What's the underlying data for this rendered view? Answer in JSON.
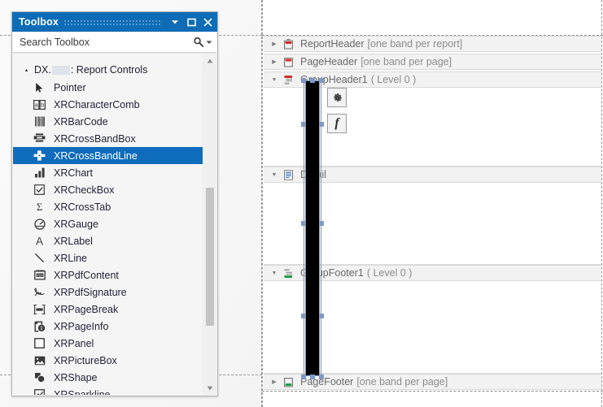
{
  "toolbox": {
    "title": "Toolbox",
    "titlebar_buttons": [
      {
        "name": "toolbox-dropdown-button",
        "icon": "chevron-down-icon",
        "glyph": "▼"
      },
      {
        "name": "toolbox-maximize-button",
        "icon": "maximize-icon",
        "glyph": "□"
      },
      {
        "name": "toolbox-close-button",
        "icon": "close-icon",
        "glyph": "✕"
      }
    ],
    "search": {
      "text": "Search Toolbox",
      "placeholder": "Search Toolbox",
      "icon": "search-icon",
      "dropdown_icon": "chevron-down-icon"
    },
    "group": {
      "expander": "▴",
      "prefix": "DX.",
      "redacted": true,
      "suffix": ": Report Controls",
      "full_label": "DX. : Report Controls"
    },
    "items": [
      {
        "label": "Pointer",
        "icon": "pointer-icon",
        "selected": false
      },
      {
        "label": "XRCharacterComb",
        "icon": "character-comb-icon",
        "selected": false
      },
      {
        "label": "XRBarCode",
        "icon": "barcode-icon",
        "selected": false
      },
      {
        "label": "XRCrossBandBox",
        "icon": "cross-band-box-icon",
        "selected": false
      },
      {
        "label": "XRCrossBandLine",
        "icon": "cross-band-line-icon",
        "selected": true
      },
      {
        "label": "XRChart",
        "icon": "chart-icon",
        "selected": false
      },
      {
        "label": "XRCheckBox",
        "icon": "checkbox-icon",
        "selected": false
      },
      {
        "label": "XRCrossTab",
        "icon": "cross-tab-icon",
        "selected": false
      },
      {
        "label": "XRGauge",
        "icon": "gauge-icon",
        "selected": false
      },
      {
        "label": "XRLabel",
        "icon": "label-icon",
        "selected": false
      },
      {
        "label": "XRLine",
        "icon": "line-icon",
        "selected": false
      },
      {
        "label": "XRPdfContent",
        "icon": "pdf-content-icon",
        "selected": false
      },
      {
        "label": "XRPdfSignature",
        "icon": "pdf-signature-icon",
        "selected": false
      },
      {
        "label": "XRPageBreak",
        "icon": "page-break-icon",
        "selected": false
      },
      {
        "label": "XRPageInfo",
        "icon": "page-info-icon",
        "selected": false
      },
      {
        "label": "XRPanel",
        "icon": "panel-icon",
        "selected": false
      },
      {
        "label": "XRPictureBox",
        "icon": "picture-box-icon",
        "selected": false
      },
      {
        "label": "XRShape",
        "icon": "shape-icon",
        "selected": false
      },
      {
        "label": "XRSparkline",
        "icon": "sparkline-icon",
        "selected": false
      }
    ],
    "scrollbar": {
      "up_glyph": "▲",
      "down_glyph": "▼"
    }
  },
  "designer": {
    "bands": [
      {
        "name": "ReportHeader",
        "suffix": "[one band per report]",
        "expanded": false,
        "icon": "report-header-band-icon"
      },
      {
        "name": "PageHeader",
        "suffix": "[one band per page]",
        "expanded": false,
        "icon": "page-header-band-icon"
      },
      {
        "name": "GroupHeader1",
        "suffix": "( Level 0 )",
        "expanded": true,
        "icon": "group-header-band-icon"
      },
      {
        "name": "Detail",
        "suffix": "",
        "expanded": true,
        "icon": "detail-band-icon"
      },
      {
        "name": "GroupFooter1",
        "suffix": "( Level 0 )",
        "expanded": true,
        "icon": "group-footer-band-icon"
      },
      {
        "name": "PageFooter",
        "suffix": "[one band per page]",
        "expanded": false,
        "icon": "page-footer-band-icon"
      }
    ],
    "expander_collapsed_glyph": "▶",
    "expander_expanded_glyph": "▼",
    "selected_control": {
      "name": "XRCrossBandLine",
      "color": "#000000",
      "selection_color": "#7e99c4"
    },
    "smart_buttons": [
      {
        "name": "smart-tag-button",
        "icon": "gear-icon"
      },
      {
        "name": "expression-button",
        "icon": "fx-icon",
        "glyph": "f"
      }
    ]
  },
  "colors": {
    "accent": "#0d6cb5",
    "selection": "#0f6cbd",
    "band_header_bg": "#f2f2f2",
    "toolbox_bg": "#f5f5f5"
  }
}
